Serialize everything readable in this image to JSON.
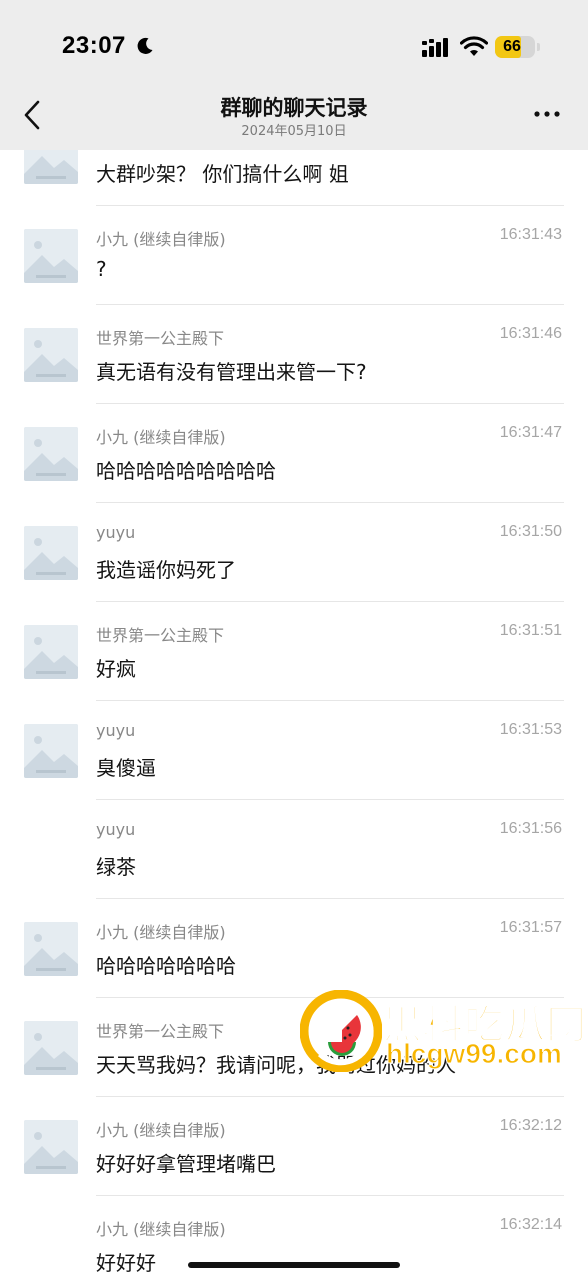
{
  "status_bar": {
    "time": "23:07",
    "battery_level": "66",
    "battery_fraction": 0.66
  },
  "nav": {
    "title": "群聊的聊天记录",
    "subtitle": "2024年05月10日"
  },
  "messages": [
    {
      "sender": "",
      "time": "",
      "text": "大群吵架？ 你们搞什么啊 姐",
      "avatar": true
    },
    {
      "sender": "小九 (继续自律版)",
      "time": "16:31:43",
      "text": "?",
      "avatar": true
    },
    {
      "sender": "世界第一公主殿下",
      "time": "16:31:46",
      "text": "真无语有没有管理出来管一下?",
      "avatar": true
    },
    {
      "sender": "小九 (继续自律版)",
      "time": "16:31:47",
      "text": "哈哈哈哈哈哈哈哈哈",
      "avatar": true
    },
    {
      "sender": "yuyu",
      "time": "16:31:50",
      "text": "我造谣你妈死了",
      "avatar": true
    },
    {
      "sender": "世界第一公主殿下",
      "time": "16:31:51",
      "text": "好疯",
      "avatar": true
    },
    {
      "sender": "yuyu",
      "time": "16:31:53",
      "text": "臭傻逼",
      "avatar": true
    },
    {
      "sender": "yuyu",
      "time": "16:31:56",
      "text": "绿茶",
      "avatar": false
    },
    {
      "sender": "小九 (继续自律版)",
      "time": "16:31:57",
      "text": "哈哈哈哈哈哈哈",
      "avatar": true
    },
    {
      "sender": "世界第一公主殿下",
      "time": "",
      "text": "天天骂我妈？我请问呢，我骂过你妈的人",
      "avatar": true
    },
    {
      "sender": "小九 (继续自律版)",
      "time": "16:32:12",
      "text": "好好好拿管理堵嘴巴",
      "avatar": true
    },
    {
      "sender": "小九 (继续自律版)",
      "time": "16:32:14",
      "text": "好好好",
      "avatar": false
    }
  ],
  "watermark": {
    "title": "黑料吃瓜网",
    "domain": "hlcgw99.com"
  },
  "colors": {
    "header_bg": "#ededed",
    "battery_fill": "#f2c713",
    "watermark": "#f7b500"
  }
}
